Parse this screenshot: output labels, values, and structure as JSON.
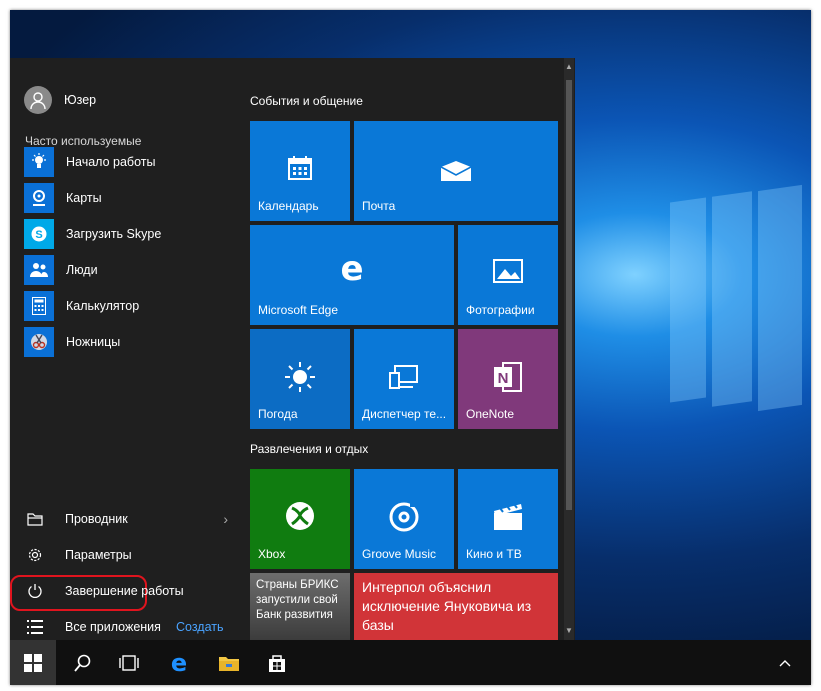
{
  "user": {
    "name": "Юзер"
  },
  "frequent": {
    "header": "Часто используемые",
    "items": [
      {
        "label": "Начало работы",
        "icon": "lightbulb-icon"
      },
      {
        "label": "Карты",
        "icon": "maps-icon"
      },
      {
        "label": "Загрузить Skype",
        "icon": "skype-icon"
      },
      {
        "label": "Люди",
        "icon": "people-icon"
      },
      {
        "label": "Калькулятор",
        "icon": "calculator-icon"
      },
      {
        "label": "Ножницы",
        "icon": "scissors-icon"
      }
    ]
  },
  "bottom": {
    "explorer": "Проводник",
    "settings": "Параметры",
    "shutdown": "Завершение работы",
    "all_apps": "Все приложения",
    "create": "Создать"
  },
  "groups": {
    "events": "События и общение",
    "entertainment": "Развлечения и отдых"
  },
  "tiles": {
    "calendar": "Календарь",
    "mail": "Почта",
    "edge": "Microsoft Edge",
    "photos": "Фотографии",
    "weather": "Погода",
    "phone": "Диспетчер те...",
    "onenote": "OneNote",
    "xbox": "Xbox",
    "groove": "Groove Music",
    "movies": "Кино и ТВ",
    "news1": "Страны БРИКС запустили свой Банк развития",
    "news2": "Интерпол объяснил исключение Януковича из базы"
  },
  "colors": {
    "accent": "#0a78d7",
    "onenote": "#80397b",
    "xbox": "#107c10",
    "news": "#d13438",
    "highlight": "#e0141e"
  },
  "taskbar": {
    "icons": [
      "windows-start-icon",
      "search-icon",
      "task-view-icon",
      "edge-icon",
      "file-explorer-icon",
      "store-icon"
    ],
    "tray": "chevron-up-icon"
  }
}
